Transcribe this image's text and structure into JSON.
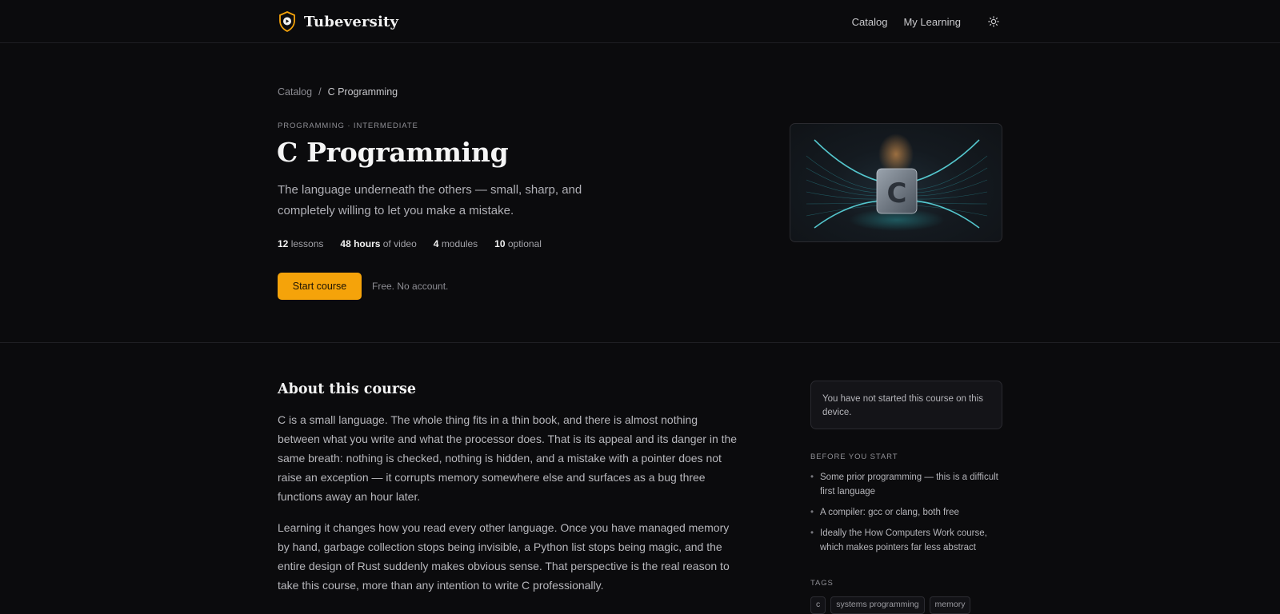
{
  "header": {
    "brand": "Tubeversity",
    "nav": [
      "Catalog",
      "My Learning"
    ],
    "theme_toggle_icon": "sun-icon"
  },
  "hero": {
    "breadcrumb": {
      "root": "Catalog",
      "separator": "/",
      "current": "C Programming"
    },
    "kicker": "PROGRAMMING · INTERMEDIATE",
    "title": "C Programming",
    "subtitle": "The language underneath the others — small, sharp, and completely willing to let you make a mistake.",
    "stats": [
      {
        "value": "12",
        "label": "lessons"
      },
      {
        "value": "48 hours",
        "label": "of video"
      },
      {
        "value": "4",
        "label": "modules"
      },
      {
        "value": "10",
        "label": "optional"
      }
    ],
    "cta_label": "Start course",
    "cta_note": "Free. No account.",
    "image_letter": "C"
  },
  "about": {
    "title": "About this course",
    "paragraphs": [
      "C is a small language. The whole thing fits in a thin book, and there is almost nothing between what you write and what the processor does. That is its appeal and its danger in the same breath: nothing is checked, nothing is hidden, and a mistake with a pointer does not raise an exception — it corrupts memory somewhere else and surfaces as a bug three functions away an hour later.",
      "Learning it changes how you read every other language. Once you have managed memory by hand, garbage collection stops being invisible, a Python list stops being magic, and the entire design of Rust suddenly makes obvious sense. That perspective is the real reason to take this course, more than any intention to write C professionally."
    ]
  },
  "sidebar": {
    "status": "You have not started this course on this device.",
    "prereq_heading": "BEFORE YOU START",
    "prereqs": [
      "Some prior programming — this is a difficult first language",
      "A compiler: gcc or clang, both free",
      "Ideally the How Computers Work course, which makes pointers far less abstract"
    ],
    "bullet": "•",
    "tags_heading": "TAGS",
    "tags": [
      "c",
      "systems programming",
      "memory"
    ]
  },
  "colors": {
    "accent": "#f5a30a",
    "background": "#0b0b0d",
    "brand_shield": "#f5a30a"
  }
}
